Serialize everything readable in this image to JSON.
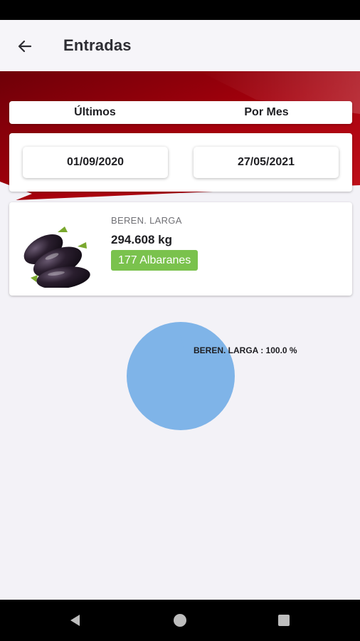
{
  "app_bar": {
    "title": "Entradas"
  },
  "tabs": [
    {
      "label": "Últimos"
    },
    {
      "label": "Por Mes"
    }
  ],
  "date_range": {
    "from": "01/09/2020",
    "to": "27/05/2021"
  },
  "product": {
    "name": "BEREN. LARGA",
    "weight": "294.608 kg",
    "badge": "177 Albaranes",
    "badge_color": "#7ac24d"
  },
  "chart_data": {
    "type": "pie",
    "categories": [
      "BEREN. LARGA"
    ],
    "values": [
      100.0
    ],
    "labels": [
      "BEREN. LARGA : 100.0 %"
    ],
    "colors": [
      "#7fb4e8"
    ]
  },
  "icons": {
    "back": "arrow-left-icon",
    "nav": [
      "back-triangle-icon",
      "home-circle-icon",
      "recents-square-icon"
    ]
  },
  "colors": {
    "hero_red": "#a3000b",
    "background": "#f3f2f7"
  }
}
